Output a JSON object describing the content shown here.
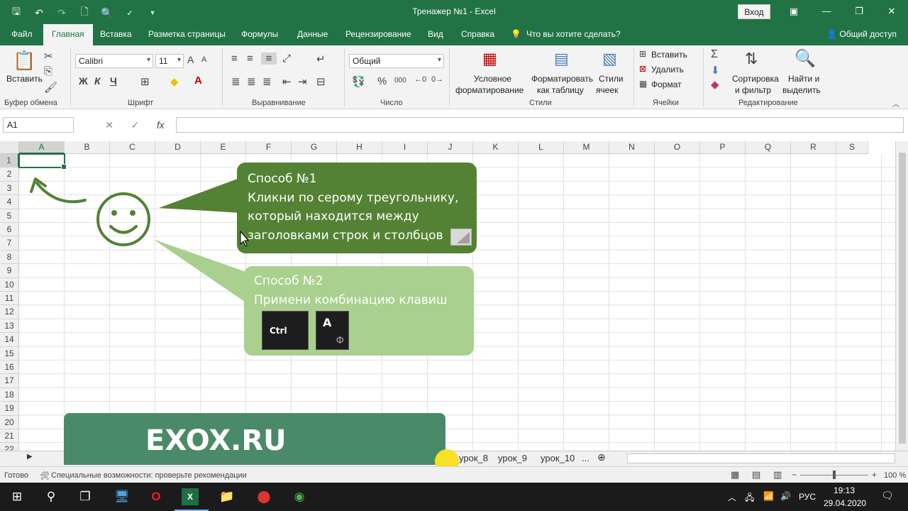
{
  "window": {
    "title": "Тренажер №1  -  Excel",
    "login_label": "Вход",
    "qat_icons": [
      "save-icon",
      "undo-icon",
      "redo-icon",
      "new-doc-icon",
      "print-preview-icon",
      "spelling-icon",
      "customize-icon"
    ],
    "accent_color": "#217346"
  },
  "ribbon_tabs": [
    "Файл",
    "Главная",
    "Вставка",
    "Разметка страницы",
    "Формулы",
    "Данные",
    "Рецензирование",
    "Вид",
    "Справка"
  ],
  "tell_me": "Что вы хотите сделать?",
  "share_label": "Общий доступ",
  "ribbon": {
    "clipboard": {
      "paste": "Вставить",
      "label": "Буфер обмена"
    },
    "font": {
      "name": "Calibri",
      "size": "11",
      "label": "Шрифт",
      "bold": "Ж",
      "italic": "К",
      "underline": "Ч",
      "grow": "A",
      "shrink": "A"
    },
    "alignment": {
      "label": "Выравнивание"
    },
    "number": {
      "format": "Общий",
      "label": "Число",
      "percent": "%",
      "thousands": "000"
    },
    "styles": {
      "conditional_1": "Условное",
      "conditional_2": "форматирование",
      "table_1": "Форматировать",
      "table_2": "как таблицу",
      "cell_1": "Стили",
      "cell_2": "ячеек",
      "label": "Стили"
    },
    "cells": {
      "insert": "Вставить",
      "delete": "Удалить",
      "format": "Формат",
      "label": "Ячейки"
    },
    "editing": {
      "sort_1": "Сортировка",
      "sort_2": "и фильтр",
      "find_1": "Найти и",
      "find_2": "выделить",
      "label": "Редактирование",
      "sum": "Σ"
    }
  },
  "formula_bar": {
    "name_box": "A1",
    "cancel": "✕",
    "enter": "✓",
    "fx": "fx",
    "value": ""
  },
  "columns": [
    "A",
    "B",
    "C",
    "D",
    "E",
    "F",
    "G",
    "H",
    "I",
    "J",
    "K",
    "L",
    "M",
    "N",
    "O",
    "P",
    "Q",
    "R",
    "S"
  ],
  "rows": [
    "1",
    "2",
    "3",
    "4",
    "5",
    "6",
    "7",
    "8",
    "9",
    "10",
    "11",
    "12",
    "13",
    "14",
    "15",
    "16",
    "17",
    "18",
    "19",
    "20",
    "21",
    "22"
  ],
  "callout1": {
    "title": "Способ №1",
    "line1": "Кликни по серому треугольнику,",
    "line2": "который находится между",
    "line3": "заголовками строк и столбцов"
  },
  "callout2": {
    "title": "Способ №2",
    "line1": "Примени комбинацию клавиш",
    "key1": "Ctrl",
    "key2": "A",
    "key2_alt": "Ф"
  },
  "banner": {
    "text": "EXOX.RU"
  },
  "sheet_tabs": [
    "урок_8",
    "урок_9",
    "урок_10"
  ],
  "sheet_more": "...",
  "status": {
    "ready": "Готово",
    "accessibility": "Специальные возможности: проверьте рекомендации",
    "zoom": "100 %",
    "zoom_minus": "−",
    "zoom_plus": "+"
  },
  "taskbar": {
    "lang": "РУС",
    "time": "19:13",
    "date": "29.04.2020"
  }
}
